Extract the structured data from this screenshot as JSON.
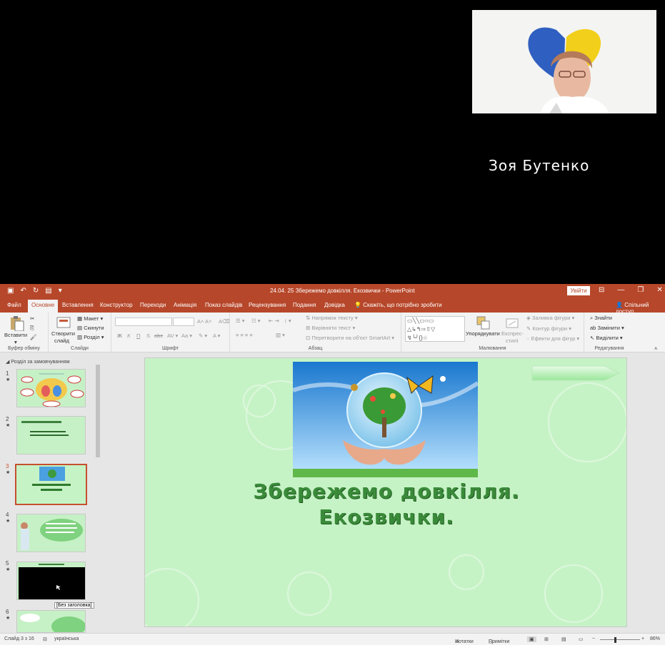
{
  "video": {
    "participant_name": "Зоя Бутенко"
  },
  "window": {
    "title": "24.04. 25 Збережемо довкілля. Екозвички - PowerPoint",
    "login_label": "Увійти",
    "minimize": "—",
    "restore": "❐",
    "close": "✕"
  },
  "tabs": [
    {
      "label": "Файл"
    },
    {
      "label": "Основне"
    },
    {
      "label": "Вставлення"
    },
    {
      "label": "Конструктор"
    },
    {
      "label": "Переходи"
    },
    {
      "label": "Анімація"
    },
    {
      "label": "Показ слайдів"
    },
    {
      "label": "Рецензування"
    },
    {
      "label": "Подання"
    },
    {
      "label": "Довідка"
    }
  ],
  "tellme": "Скажіть, що потрібно зробити",
  "share": "Спільний доступ",
  "ribbon": {
    "paste": "Вставити",
    "clipboard_group": "Буфер обміну",
    "new_slide_line1": "Створити",
    "new_slide_line2": "слайд",
    "layout": "Макет",
    "reset": "Скинути",
    "section": "Розділ",
    "slides_group": "Слайди",
    "font_group": "Шрифт",
    "paragraph_group": "Абзац",
    "text_direction": "Напрямок тексту",
    "align_text": "Вирівняти текст",
    "smartart": "Перетворити на об'єкт SmartArt",
    "arrange": "Упорядкувати",
    "quick_styles_line1": "Експрес-",
    "quick_styles_line2": "стилі",
    "shape_fill": "Заливка фігури",
    "shape_outline": "Контур фігури",
    "shape_effects": "Ефекти для фігур",
    "drawing_group": "Малювання",
    "find": "Знайти",
    "replace": "Замінити",
    "select": "Виділити",
    "editing_group": "Редагування",
    "bold": "Ж",
    "italic": "К",
    "underline": "П",
    "shadow": "S",
    "strike": "abc"
  },
  "thumbnails": {
    "section_name": "Розділ за замовчуванням",
    "items": [
      {
        "num": "1",
        "star": "★"
      },
      {
        "num": "2",
        "star": "★"
      },
      {
        "num": "3",
        "star": "★"
      },
      {
        "num": "4",
        "star": "★"
      },
      {
        "num": "5",
        "star": "★"
      },
      {
        "num": "6",
        "star": "★"
      }
    ],
    "tooltip": "[Без заголовка]"
  },
  "slide": {
    "title_line1": "Збережемо довкілля.",
    "title_line2": "Екозвички."
  },
  "status": {
    "slide_info": "Слайд 3 з 16",
    "language": "українська",
    "notes": "Нотатки",
    "comments": "Примітки",
    "zoom": "86%"
  },
  "colors": {
    "ribbon_accent": "#b7472a",
    "slide_bg": "#c6f3c6",
    "title_green": "#3a8a3a"
  }
}
